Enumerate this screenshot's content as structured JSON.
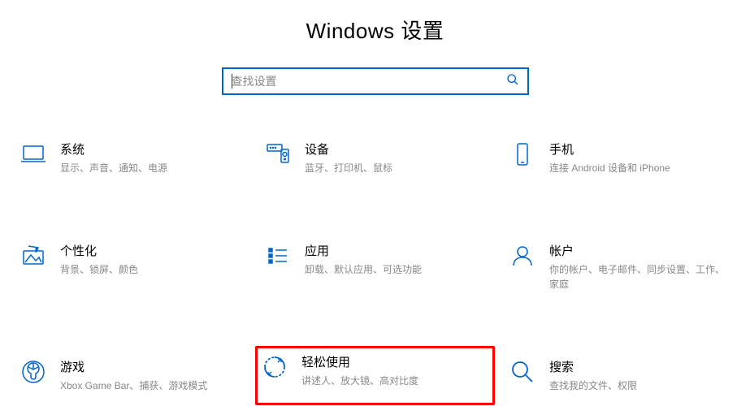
{
  "header": {
    "title": "Windows 设置"
  },
  "search": {
    "placeholder": "查找设置"
  },
  "categories": [
    {
      "icon": "laptop-icon",
      "title": "系统",
      "desc": "显示、声音、通知、电源"
    },
    {
      "icon": "devices-icon",
      "title": "设备",
      "desc": "蓝牙、打印机、鼠标"
    },
    {
      "icon": "phone-icon",
      "title": "手机",
      "desc": "连接 Android 设备和 iPhone"
    },
    {
      "icon": "personalization-icon",
      "title": "个性化",
      "desc": "背景、锁屏、颜色"
    },
    {
      "icon": "apps-icon",
      "title": "应用",
      "desc": "卸载、默认应用、可选功能"
    },
    {
      "icon": "accounts-icon",
      "title": "帐户",
      "desc": "你的帐户、电子邮件、同步设置、工作、家庭"
    },
    {
      "icon": "gaming-icon",
      "title": "游戏",
      "desc": "Xbox Game Bar、捕获、游戏模式"
    },
    {
      "icon": "ease-of-access-icon",
      "title": "轻松使用",
      "desc": "讲述人、放大镜、高对比度",
      "highlighted": true
    },
    {
      "icon": "search-category-icon",
      "title": "搜索",
      "desc": "查找我的文件、权限"
    }
  ]
}
